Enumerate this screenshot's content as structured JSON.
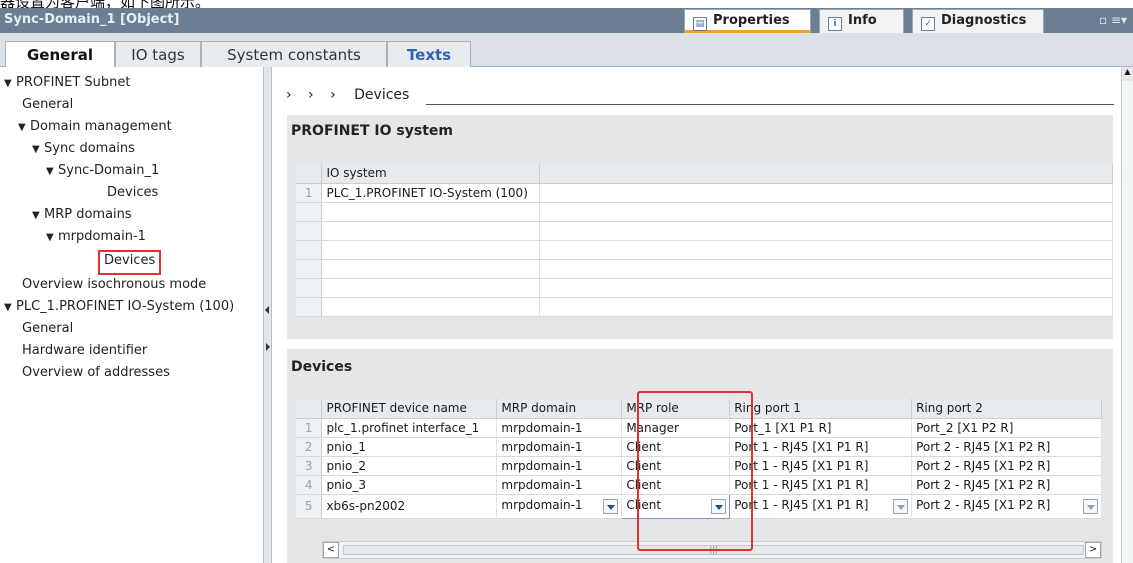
{
  "top_strip_text": "器设置为客户端，如下图所示。",
  "window": {
    "title": "Sync-Domain_1 [Object]",
    "tabs": [
      {
        "label": "Properties",
        "icon": "properties-icon"
      },
      {
        "label": "Info",
        "icon": "info-icon"
      },
      {
        "label": "Diagnostics",
        "icon": "diagnostics-icon"
      }
    ]
  },
  "subtabs": [
    "General",
    "IO tags",
    "System constants",
    "Texts"
  ],
  "nav": [
    {
      "label": "PROFINET Subnet",
      "expanded": true
    },
    {
      "label": "General"
    },
    {
      "label": "Domain management",
      "expanded": true
    },
    {
      "label": "Sync domains",
      "expanded": true
    },
    {
      "label": "Sync-Domain_1",
      "expanded": true
    },
    {
      "label": "Devices"
    },
    {
      "label": "MRP domains",
      "expanded": true
    },
    {
      "label": "mrpdomain-1",
      "expanded": true
    },
    {
      "label": "Devices"
    },
    {
      "label": "Overview isochronous mode"
    },
    {
      "label": "PLC_1.PROFINET IO-System (100)",
      "expanded": true
    },
    {
      "label": "General"
    },
    {
      "label": "Hardware identifier"
    },
    {
      "label": "Overview of addresses"
    }
  ],
  "breadcrumb": {
    "arrows": "› › ›",
    "label": "Devices"
  },
  "io_system_section": {
    "title": "PROFINET IO system",
    "header": "IO system",
    "rows": [
      {
        "num": "1",
        "value": "PLC_1.PROFINET IO-System (100)"
      }
    ]
  },
  "devices_section": {
    "title": "Devices",
    "headers": [
      "PROFINET device name",
      "MRP domain",
      "MRP role",
      "Ring port 1",
      "Ring port 2"
    ],
    "rows": [
      {
        "num": "1",
        "name": "plc_1.profinet interface_1",
        "domain": "mrpdomain-1",
        "role": "Manager",
        "port1": "Port_1 [X1 P1 R]",
        "port2": "Port_2 [X1 P2 R]"
      },
      {
        "num": "2",
        "name": "pnio_1",
        "domain": "mrpdomain-1",
        "role": "Client",
        "port1": "Port 1 - RJ45 [X1 P1 R]",
        "port2": "Port 2 - RJ45 [X1 P2 R]"
      },
      {
        "num": "3",
        "name": "pnio_2",
        "domain": "mrpdomain-1",
        "role": "Client",
        "port1": "Port 1 - RJ45 [X1 P1 R]",
        "port2": "Port 2 - RJ45 [X1 P2 R]"
      },
      {
        "num": "4",
        "name": "pnio_3",
        "domain": "mrpdomain-1",
        "role": "Client",
        "port1": "Port 1 - RJ45 [X1 P1 R]",
        "port2": "Port 2 - RJ45 [X1 P2 R]"
      },
      {
        "num": "5",
        "name": "xb6s-pn2002",
        "domain": "mrpdomain-1",
        "role": "Client",
        "port1": "Port 1 - RJ45 [X1 P1 R]",
        "port2": "Port 2 - RJ45 [X1 P2 R]"
      }
    ]
  },
  "colors": {
    "titlebar": "#6b7f93",
    "highlight": "#e03030",
    "active_tab_underline": "#f2a22e",
    "texts_tab": "#2b63b6"
  }
}
